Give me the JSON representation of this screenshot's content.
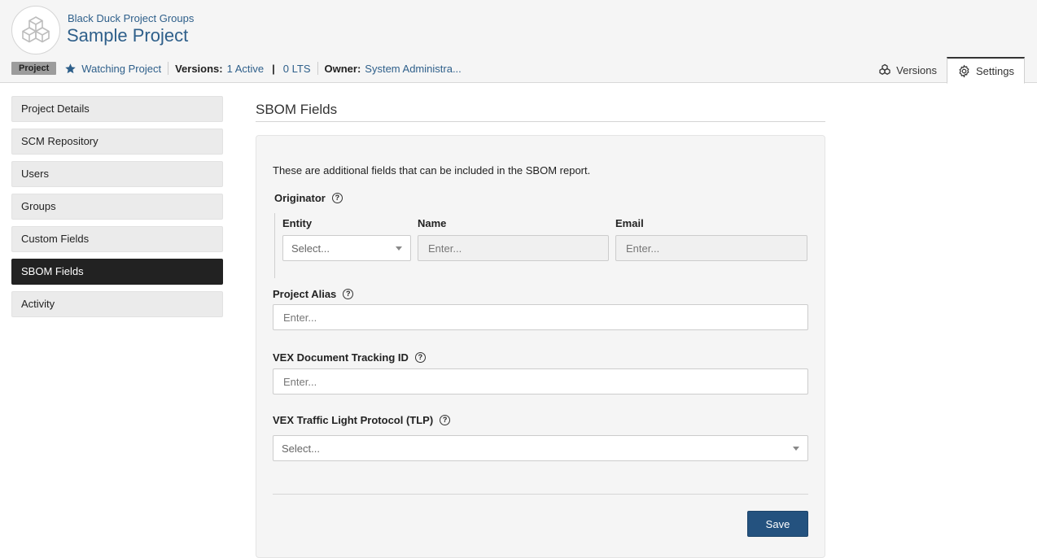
{
  "header": {
    "parent_group": "Black Duck Project Groups",
    "title": "Sample Project",
    "logo_icon": "cubes-icon",
    "badge": "Project",
    "watching": "Watching Project",
    "versions_label": "Versions:",
    "versions_active": "1 Active",
    "versions_separator": "|",
    "versions_lts": "0 LTS",
    "owner_label": "Owner:",
    "owner_value": "System Administra..."
  },
  "tabs": [
    {
      "label": "Versions",
      "icon": "versions-icon",
      "active": false
    },
    {
      "label": "Settings",
      "icon": "gear-icon",
      "active": true
    }
  ],
  "sidebar": {
    "items": [
      {
        "label": "Project Details",
        "active": false
      },
      {
        "label": "SCM Repository",
        "active": false
      },
      {
        "label": "Users",
        "active": false
      },
      {
        "label": "Groups",
        "active": false
      },
      {
        "label": "Custom Fields",
        "active": false
      },
      {
        "label": "SBOM Fields",
        "active": true
      },
      {
        "label": "Activity",
        "active": false
      }
    ]
  },
  "main": {
    "section_title": "SBOM Fields",
    "description": "These are additional fields that can be included in the SBOM report.",
    "originator": {
      "label": "Originator",
      "entity_label": "Entity",
      "entity_value": "Select...",
      "name_label": "Name",
      "name_placeholder": "Enter...",
      "email_label": "Email",
      "email_placeholder": "Enter..."
    },
    "project_alias": {
      "label": "Project Alias",
      "placeholder": "Enter..."
    },
    "vex_tracking": {
      "label": "VEX Document Tracking ID",
      "placeholder": "Enter..."
    },
    "vex_tlp": {
      "label": "VEX Traffic Light Protocol (TLP)",
      "value": "Select..."
    },
    "help_glyph": "?",
    "save_label": "Save"
  },
  "colors": {
    "link": "#2e5f8a",
    "primary_button": "#24527f",
    "active_nav": "#222222"
  }
}
